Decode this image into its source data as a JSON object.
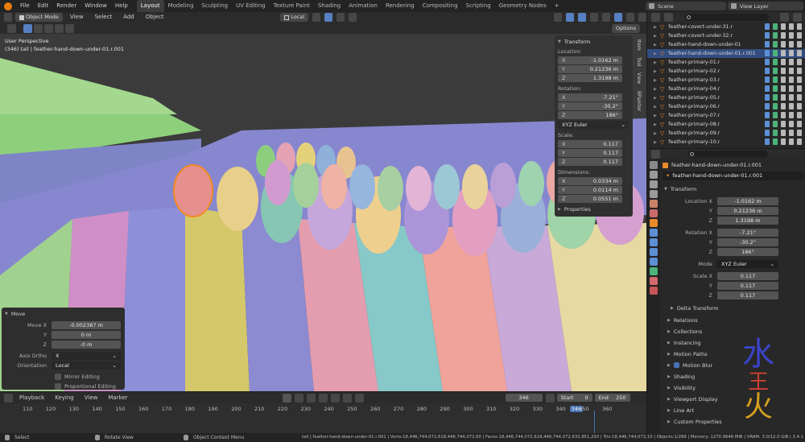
{
  "menu": [
    "File",
    "Edit",
    "Render",
    "Window",
    "Help"
  ],
  "workspaces": [
    "Layout",
    "Modeling",
    "Sculpting",
    "UV Editing",
    "Texture Paint",
    "Shading",
    "Animation",
    "Rendering",
    "Compositing",
    "Scripting",
    "Geometry Nodes"
  ],
  "workspace_add": "+",
  "scene": {
    "name": "Scene",
    "view_layer": "View Layer"
  },
  "viewport_header": {
    "mode": "Object Mode",
    "menus": [
      "View",
      "Select",
      "Add",
      "Object"
    ],
    "orientation": "Local",
    "options": "Options"
  },
  "viewport": {
    "perspective": "User Perspective",
    "info": "(346) tail | feather-hand-down-under-01.r.001"
  },
  "npanel": {
    "tabs": [
      "Item",
      "Tool",
      "View",
      "BPainter"
    ],
    "title": "Transform",
    "location_label": "Location:",
    "location": {
      "x": "-1.0162 m",
      "y": "0.21236 m",
      "z": "1.3198 m"
    },
    "rotation_label": "Rotation:",
    "rotation": {
      "x": "-7.21°",
      "y": "-30.2°",
      "z": "186°"
    },
    "rotation_mode": "XYZ Euler",
    "scale_label": "Scale:",
    "scale": {
      "x": "0.117",
      "y": "0.117",
      "z": "0.117"
    },
    "dimensions_label": "Dimensions:",
    "dimensions": {
      "x": "0.0334 m",
      "y": "0.0114 m",
      "z": "0.0551 m"
    },
    "properties": "Properties"
  },
  "axes": {
    "x": "X",
    "y": "Y",
    "z": "Z"
  },
  "operator": {
    "title": "Move",
    "move_x_label": "Move X",
    "move_x": "-0.002387 m",
    "y_label": "Y",
    "y": "0 m",
    "z_label": "Z",
    "z": "-0 m",
    "axis_ortho_label": "Axis Ortho",
    "axis_ortho": "X",
    "orientation_label": "Orientation",
    "orientation": "Local",
    "mirror": "Mirror Editing",
    "proportional": "Proportional Editing"
  },
  "outliner": {
    "items": [
      "feather-covert-under-31.r",
      "feather-covert-under-32.r",
      "feather-hand-down-under-01",
      "feather-hand-down-under-01.r.001",
      "feather-primary-01.r",
      "feather-primary-02.r",
      "feather-primary-03.r",
      "feather-primary-04.r",
      "feather-primary-05.r",
      "feather-primary-06.r",
      "feather-primary-07.r",
      "feather-primary-08.r",
      "feather-primary-09.r",
      "feather-primary-10.r"
    ],
    "selected_index": 3
  },
  "properties": {
    "object_name": "feather-hand-down-under-01.r.001",
    "object_field": "feather-hand-down-under-01.r.001",
    "transform": "Transform",
    "location_x_label": "Location X",
    "location": [
      "-1.0162 m",
      "0.21236 m",
      "1.3198 m"
    ],
    "rotation_x_label": "Rotation X",
    "rotation": [
      "-7.21°",
      "-30.2°",
      "186°"
    ],
    "mode_label": "Mode",
    "mode": "XYZ Euler",
    "scale_x_label": "Scale X",
    "scale": [
      "0.117",
      "0.117",
      "0.117"
    ],
    "delta": "Delta Transform",
    "sections": [
      "Relations",
      "Collections",
      "Instancing",
      "Motion Paths",
      "Motion Blur",
      "Shading",
      "Visibility",
      "Viewport Display",
      "Line Art",
      "Custom Properties"
    ]
  },
  "timeline": {
    "menus": [
      "Playback",
      "Keying",
      "View",
      "Marker"
    ],
    "current_frame": "346",
    "start_label": "Start",
    "start": "0",
    "end_label": "End",
    "end": "250",
    "ticks": [
      "110",
      "120",
      "130",
      "140",
      "150",
      "160",
      "170",
      "180",
      "190",
      "200",
      "210",
      "220",
      "230",
      "240",
      "250",
      "260",
      "270",
      "280",
      "290",
      "300",
      "310",
      "320",
      "330",
      "340",
      "346",
      "350",
      "360"
    ]
  },
  "statusbar": {
    "select": "Select",
    "rotate": "Rotate View",
    "context": "Object Context Menu",
    "stats": "tail | feather-hand-down-under-01.r.001 | Verts:18,446,744,072,618,446,744,072,60 | Faces:18,446,744,072,618,446,744,072,632,851,293 | Tris:18,446,744,073,10 | Objects:1/289 | Memory: 1270.9646 MiB | VRAM: 3.0/12.0 GiB | 3.4.1"
  },
  "colors": {
    "accent": "#4772b3",
    "selected_row": "#334d80",
    "feather_outline": "#f08a24"
  }
}
